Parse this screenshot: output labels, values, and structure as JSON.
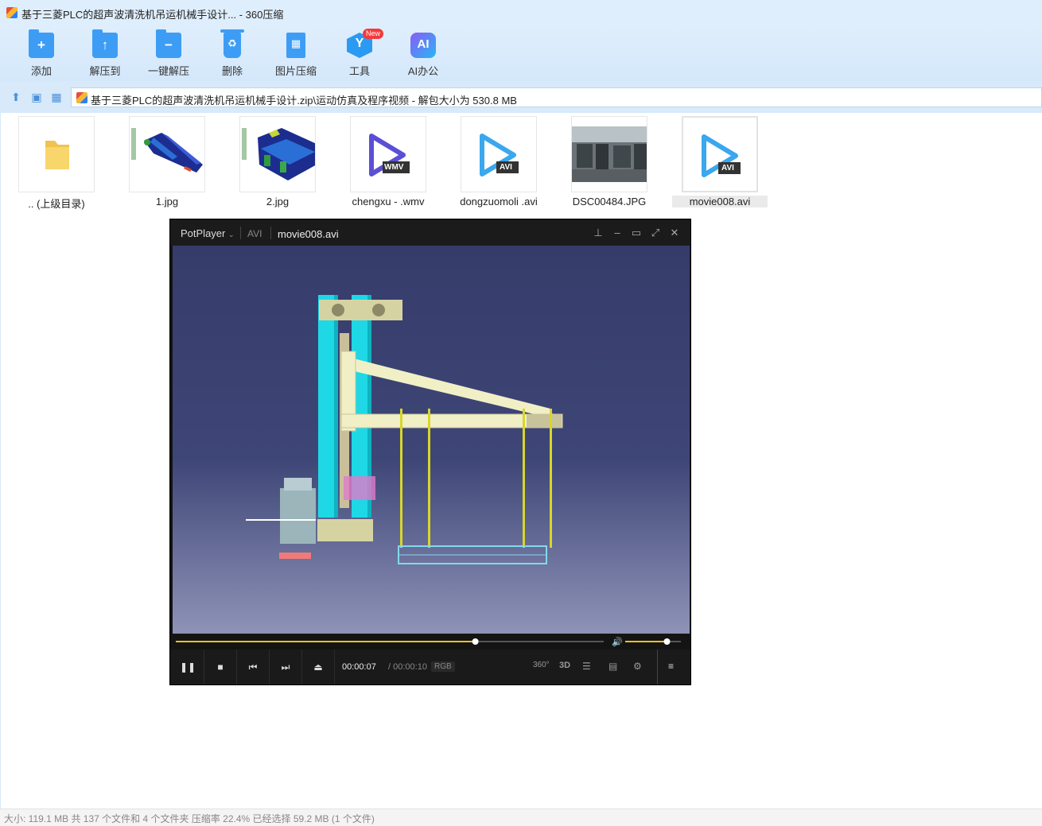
{
  "window": {
    "title": "基于三菱PLC的超声波清洗机吊运机械手设计... - 360压缩"
  },
  "toolbar": [
    {
      "label": "添加",
      "icon": "add-icon"
    },
    {
      "label": "解压到",
      "icon": "extract-to-icon"
    },
    {
      "label": "一键解压",
      "icon": "one-click-extract-icon"
    },
    {
      "label": "删除",
      "icon": "delete-icon"
    },
    {
      "label": "图片压缩",
      "icon": "image-compress-icon"
    },
    {
      "label": "工具",
      "icon": "tools-icon",
      "badge": "New"
    },
    {
      "label": "AI办公",
      "icon": "ai-office-icon",
      "glyph": "AI"
    }
  ],
  "address": {
    "path": "基于三菱PLC的超声波清洗机吊运机械手设计.zip\\运动仿真及程序视频 - 解包大小为 530.8 MB"
  },
  "files": [
    {
      "name": ".. (上级目录)",
      "type": "folder"
    },
    {
      "name": "1.jpg",
      "type": "image"
    },
    {
      "name": "2.jpg",
      "type": "image"
    },
    {
      "name": "chengxu - .wmv",
      "type": "video",
      "badge": "WMV"
    },
    {
      "name": "dongzuomoli .avi",
      "type": "video",
      "badge": "AVI"
    },
    {
      "name": "DSC00484.JPG",
      "type": "photo"
    },
    {
      "name": "movie008.avi",
      "type": "video",
      "badge": "AVI",
      "selected": true
    }
  ],
  "player": {
    "brand": "PotPlayer",
    "format": "AVI",
    "file": "movie008.avi",
    "current_time": "00:00:07",
    "total_time": "/ 00:00:10",
    "color_mode": "RGB",
    "icon_labels": {
      "vr": "360°",
      "three_d": "3D"
    },
    "progress": 0.7,
    "volume": 0.75
  },
  "statusbar": {
    "text": "大小: 119.1 MB 共 137 个文件和 4 个文件夹 压缩率 22.4% 已经选择 59.2 MB (1 个文件)"
  },
  "colors": {
    "accent": "#3d9df5",
    "seek": "#f0c419",
    "toolbar_bg": "#dfeefc"
  }
}
